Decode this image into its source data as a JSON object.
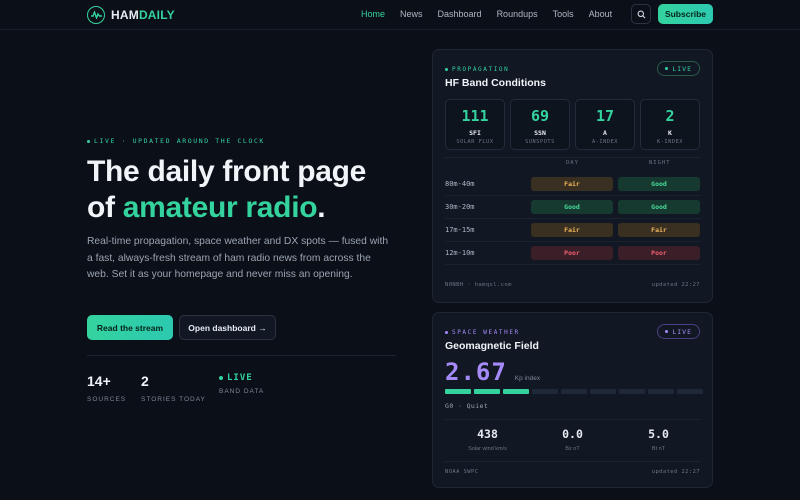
{
  "nav": {
    "logo_a": "HAM",
    "logo_b": "DAILY",
    "links": [
      "Home",
      "News",
      "Dashboard",
      "Roundups",
      "Tools",
      "About"
    ],
    "subscribe": "Subscribe"
  },
  "hero": {
    "eyebrow": "LIVE · UPDATED AROUND THE CLOCK",
    "title_1": "The daily front page",
    "title_2_pre": "of ",
    "title_2_accent": "amateur radio",
    "title_2_post": ".",
    "lede": "Real-time propagation, space weather and DX spots — fused with a fast, always-fresh stream of ham radio news from across the web. Set it as your homepage and never miss an opening.",
    "cta_primary": "Read the stream",
    "cta_secondary": "Open dashboard →",
    "stats": [
      {
        "value": "14+",
        "label": "SOURCES"
      },
      {
        "value": "2",
        "label": "STORIES TODAY"
      },
      {
        "value": "LIVE",
        "label": "BAND DATA"
      }
    ]
  },
  "propagation": {
    "eyebrow": "PROPAGATION",
    "title": "HF Band Conditions",
    "live": "LIVE",
    "metrics": [
      {
        "value": "111",
        "key": "SFI",
        "label": "SOLAR FLUX"
      },
      {
        "value": "69",
        "key": "SSN",
        "label": "SUNSPOTS"
      },
      {
        "value": "17",
        "key": "A",
        "label": "A-INDEX"
      },
      {
        "value": "2",
        "key": "K",
        "label": "K-INDEX"
      }
    ],
    "col_day": "DAY",
    "col_night": "NIGHT",
    "bands": [
      {
        "band": "80m-40m",
        "day": "Fair",
        "night": "Good"
      },
      {
        "band": "30m-20m",
        "day": "Good",
        "night": "Good"
      },
      {
        "band": "17m-15m",
        "day": "Fair",
        "night": "Fair"
      },
      {
        "band": "12m-10m",
        "day": "Poor",
        "night": "Poor"
      }
    ],
    "source": "N0NBH · hamqsl.com",
    "updated": "updated 22:27"
  },
  "space": {
    "eyebrow": "SPACE WEATHER",
    "title": "Geomagnetic Field",
    "live": "LIVE",
    "kp_value": "2.67",
    "kp_label": "Kp index",
    "kp_level": 3,
    "kp_max": 9,
    "state": "G0 · Quiet",
    "solar": [
      {
        "value": "438",
        "label": "Solar wind km/s"
      },
      {
        "value": "0.0",
        "label": "Bz nT"
      },
      {
        "value": "5.0",
        "label": "Bt nT"
      }
    ],
    "source": "NOAA SWPC",
    "updated": "updated 22:27"
  },
  "colors": {
    "accent": "#34d39e",
    "violet": "#a58bfa",
    "bg": "#0b0f17"
  }
}
